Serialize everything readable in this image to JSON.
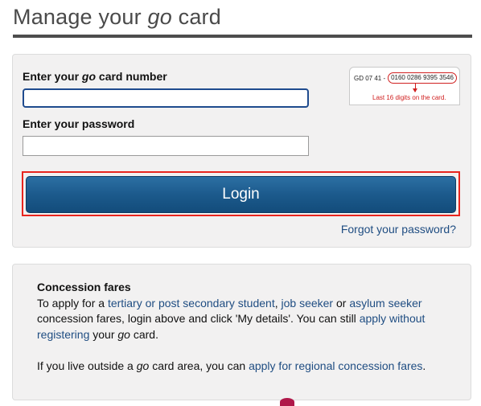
{
  "header": {
    "title_pre": "Manage your ",
    "title_italic": "go",
    "title_post": " card"
  },
  "login": {
    "card_label_pre": "Enter your ",
    "card_label_italic": "go",
    "card_label_post": " card number",
    "card_value": "",
    "password_label": "Enter your password",
    "password_value": "",
    "login_label": "Login",
    "forgot_label": "Forgot your password?"
  },
  "card_hint": {
    "prefix": "GD 07 41 -",
    "digits": "0160 0286 9395 3546",
    "caption": "Last 16 digits on the card."
  },
  "concession": {
    "heading": "Concession fares",
    "p1_a": "To apply for a ",
    "link_student": "tertiary or post secondary student",
    "p1_b": ", ",
    "link_jobseeker": "job seeker",
    "p1_c": " or ",
    "link_asylum": "asylum seeker",
    "p1_d": " concession fares, login above and click 'My details'. You can still ",
    "link_apply_without": "apply without registering",
    "p1_e": " your ",
    "p1_italic": "go",
    "p1_f": " card.",
    "p2_a": "If you live outside a ",
    "p2_italic": "go",
    "p2_b": " card area, you can ",
    "link_regional": "apply for regional concession fares",
    "p2_c": "."
  },
  "colors": {
    "accent": "#1c5a8c",
    "link": "#1f4d82",
    "highlight": "#e8251e",
    "panel": "#f2f1f1"
  }
}
